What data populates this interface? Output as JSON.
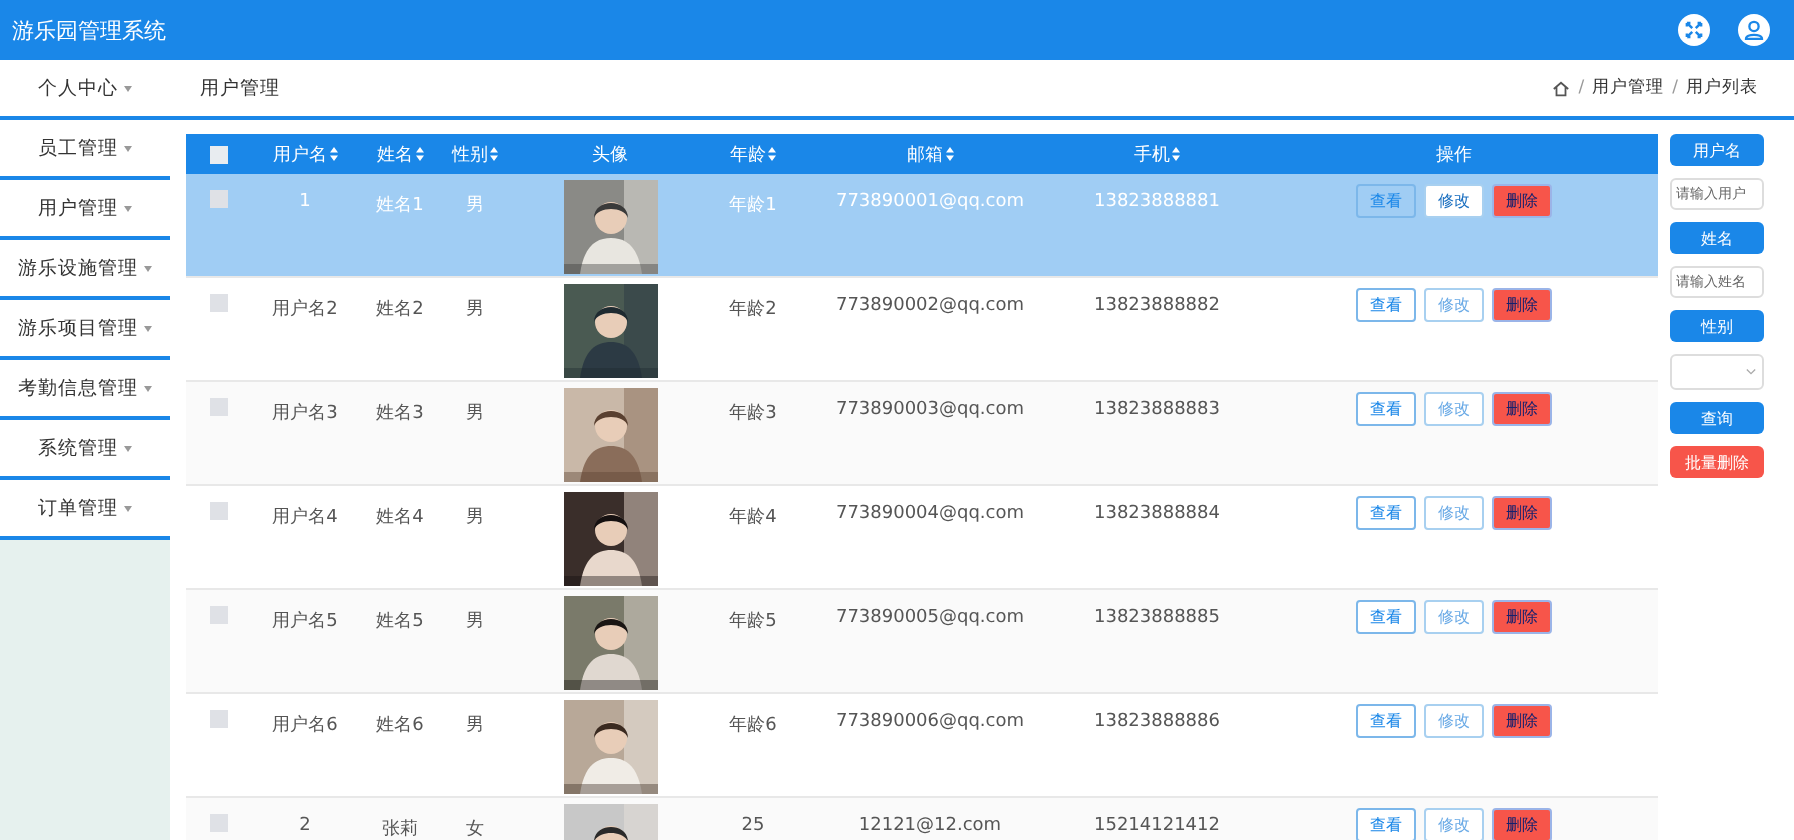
{
  "header": {
    "title": "游乐园管理系统"
  },
  "sidebar": {
    "items": [
      {
        "label": "个人中心"
      },
      {
        "label": "员工管理"
      },
      {
        "label": "用户管理"
      },
      {
        "label": "游乐设施管理"
      },
      {
        "label": "游乐项目管理"
      },
      {
        "label": "考勤信息管理"
      },
      {
        "label": "系统管理"
      },
      {
        "label": "订单管理"
      }
    ]
  },
  "page_title": "用户管理",
  "breadcrumb": [
    {
      "kind": "separator",
      "text": "/"
    },
    {
      "kind": "link",
      "text": "用户管理"
    },
    {
      "kind": "separator",
      "text": "/"
    },
    {
      "kind": "link",
      "text": "用户列表"
    }
  ],
  "table": {
    "select_all": {
      "checked": false
    },
    "columns": [
      {
        "label": "用户名",
        "sortable": true
      },
      {
        "label": "姓名",
        "sortable": true
      },
      {
        "label": "性别",
        "sortable": true
      },
      {
        "label": "头像",
        "sortable": false
      },
      {
        "label": "年龄",
        "sortable": true
      },
      {
        "label": "邮箱",
        "sortable": true
      },
      {
        "label": "手机",
        "sortable": true
      },
      {
        "label": "操作",
        "sortable": false
      }
    ],
    "rows": [
      {
        "selected": true,
        "checked": false,
        "username": "1",
        "name": "姓名1",
        "gender": "男",
        "avatar": {
          "kind": "picture"
        },
        "age": "年龄1",
        "email": "773890001@qq.com",
        "phone": "13823888881",
        "actions": [
          {
            "kind": "view",
            "label": "查看"
          },
          {
            "kind": "edit",
            "label": "修改"
          },
          {
            "kind": "delete",
            "label": "删除"
          }
        ]
      },
      {
        "selected": false,
        "checked": false,
        "username": "用户名2",
        "name": "姓名2",
        "gender": "男",
        "avatar": {
          "kind": "picture"
        },
        "age": "年龄2",
        "email": "773890002@qq.com",
        "phone": "13823888882",
        "actions": [
          {
            "kind": "view",
            "label": "查看"
          },
          {
            "kind": "edit",
            "label": "修改"
          },
          {
            "kind": "delete",
            "label": "删除"
          }
        ]
      },
      {
        "selected": false,
        "checked": false,
        "username": "用户名3",
        "name": "姓名3",
        "gender": "男",
        "avatar": {
          "kind": "picture"
        },
        "age": "年龄3",
        "email": "773890003@qq.com",
        "phone": "13823888883",
        "actions": [
          {
            "kind": "view",
            "label": "查看"
          },
          {
            "kind": "edit",
            "label": "修改"
          },
          {
            "kind": "delete",
            "label": "删除"
          }
        ]
      },
      {
        "selected": false,
        "checked": false,
        "username": "用户名4",
        "name": "姓名4",
        "gender": "男",
        "avatar": {
          "kind": "picture"
        },
        "age": "年龄4",
        "email": "773890004@qq.com",
        "phone": "13823888884",
        "actions": [
          {
            "kind": "view",
            "label": "查看"
          },
          {
            "kind": "edit",
            "label": "修改"
          },
          {
            "kind": "delete",
            "label": "删除"
          }
        ]
      },
      {
        "selected": false,
        "checked": false,
        "username": "用户名5",
        "name": "姓名5",
        "gender": "男",
        "avatar": {
          "kind": "picture"
        },
        "age": "年龄5",
        "email": "773890005@qq.com",
        "phone": "13823888885",
        "actions": [
          {
            "kind": "view",
            "label": "查看"
          },
          {
            "kind": "edit",
            "label": "修改"
          },
          {
            "kind": "delete",
            "label": "删除"
          }
        ]
      },
      {
        "selected": false,
        "checked": false,
        "username": "用户名6",
        "name": "姓名6",
        "gender": "男",
        "avatar": {
          "kind": "picture"
        },
        "age": "年龄6",
        "email": "773890006@qq.com",
        "phone": "13823888886",
        "actions": [
          {
            "kind": "view",
            "label": "查看"
          },
          {
            "kind": "edit",
            "label": "修改"
          },
          {
            "kind": "delete",
            "label": "删除"
          }
        ]
      },
      {
        "selected": false,
        "checked": false,
        "username": "2",
        "name": "张莉",
        "gender": "女",
        "avatar": {
          "kind": "picture"
        },
        "age": "25",
        "email": "12121@12.com",
        "phone": "15214121412",
        "actions": [
          {
            "kind": "view",
            "label": "查看"
          },
          {
            "kind": "edit",
            "label": "修改"
          },
          {
            "kind": "delete",
            "label": "删除"
          }
        ]
      }
    ]
  },
  "search": [
    {
      "kind": "label",
      "text": "用户名"
    },
    {
      "kind": "input",
      "placeholder": "请输入用户"
    },
    {
      "kind": "label",
      "text": "姓名"
    },
    {
      "kind": "input",
      "placeholder": "请输入姓名"
    },
    {
      "kind": "label",
      "text": "性别"
    },
    {
      "kind": "select"
    },
    {
      "kind": "button",
      "text": "查询"
    },
    {
      "kind": "danger",
      "text": "批量删除"
    }
  ]
}
